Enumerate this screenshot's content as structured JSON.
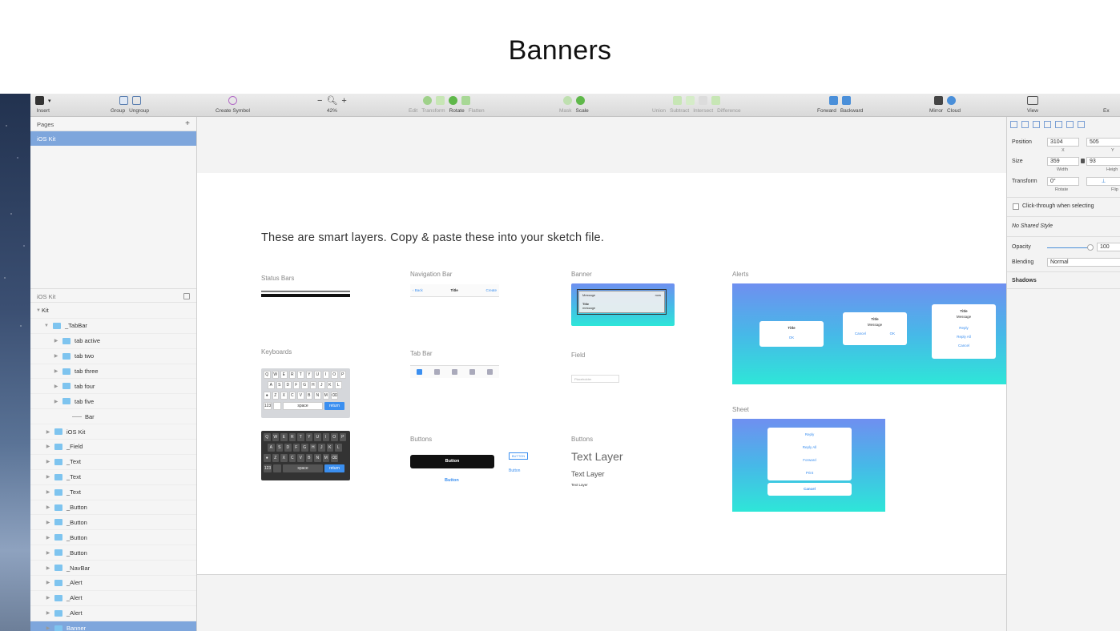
{
  "slide_title": "Banners",
  "toolbar": {
    "insert": "Insert",
    "group": "Group",
    "ungroup": "Ungroup",
    "create_symbol": "Create Symbol",
    "zoom_minus": "−",
    "zoom_plus": "+",
    "zoom": "42%",
    "edit": "Edit",
    "transform": "Transform",
    "rotate": "Rotate",
    "flatten": "Flatten",
    "mask": "Mask",
    "scale": "Scale",
    "union": "Union",
    "subtract": "Subtract",
    "intersect": "Intersect",
    "difference": "Difference",
    "forward": "Forward",
    "backward": "Backward",
    "mirror": "Mirror",
    "cloud": "Cloud",
    "view": "View",
    "export": "Ex"
  },
  "pages": {
    "header": "Pages",
    "add": "+",
    "items": [
      "iOS Kit"
    ]
  },
  "layers": {
    "header": "iOS Kit",
    "items": [
      {
        "label": "Kit",
        "type": "page"
      },
      {
        "label": "_TabBar",
        "type": "folder",
        "expanded": true
      },
      {
        "label": "tab active",
        "type": "folder"
      },
      {
        "label": "tab two",
        "type": "folder"
      },
      {
        "label": "tab three",
        "type": "folder"
      },
      {
        "label": "tab four",
        "type": "folder"
      },
      {
        "label": "tab five",
        "type": "folder"
      },
      {
        "label": "Bar",
        "type": "line"
      },
      {
        "label": "iOS Kit",
        "type": "folder"
      },
      {
        "label": "_Field",
        "type": "folder"
      },
      {
        "label": "_Text",
        "type": "folder"
      },
      {
        "label": "_Text",
        "type": "folder"
      },
      {
        "label": "_Text",
        "type": "folder"
      },
      {
        "label": "_Button",
        "type": "folder"
      },
      {
        "label": "_Button",
        "type": "folder"
      },
      {
        "label": "_Button",
        "type": "folder"
      },
      {
        "label": "_Button",
        "type": "folder"
      },
      {
        "label": "_NavBar",
        "type": "folder"
      },
      {
        "label": "_Alert",
        "type": "folder"
      },
      {
        "label": "_Alert",
        "type": "folder"
      },
      {
        "label": "_Alert",
        "type": "folder"
      },
      {
        "label": "Banner",
        "type": "folder",
        "selected": true
      }
    ]
  },
  "canvas": {
    "headline": "These are smart layers. Copy & paste these into your sketch file.",
    "sections": {
      "status_bars": "Status Bars",
      "navigation_bar": "Navigation Bar",
      "banner": "Banner",
      "alerts": "Alerts",
      "keyboards": "Keyboards",
      "tab_bar": "Tab Bar",
      "field": "Field",
      "sheet": "Sheet",
      "buttons_1": "Buttons",
      "buttons_2": "Buttons"
    },
    "nav_bar": {
      "back": "‹ Back",
      "title": "Title",
      "action": "Create"
    },
    "banner_preview": {
      "app": "Message",
      "time": "now",
      "title": "Title",
      "message": "message"
    },
    "field_placeholder": "Placeholder",
    "buttons": {
      "primary": "Button",
      "outline": "BUTTON",
      "link": "Button",
      "link2": "Button"
    },
    "text_layers": {
      "large": "Text Layer",
      "medium": "Text Layer",
      "small": "Text Layer"
    },
    "keyboard_rows": [
      [
        "Q",
        "W",
        "E",
        "R",
        "T",
        "Y",
        "U",
        "I",
        "O",
        "P"
      ],
      [
        "A",
        "S",
        "D",
        "F",
        "G",
        "H",
        "J",
        "K",
        "L"
      ],
      [
        "Z",
        "X",
        "C",
        "V",
        "B",
        "N",
        "M"
      ]
    ],
    "keyboard_light": {
      "num": "123",
      "space": "space",
      "return": "return"
    },
    "keyboard_dark": {
      "num": "123",
      "space": "space",
      "return": "return"
    },
    "alerts": {
      "a1": {
        "title": "Title",
        "ok": "OK"
      },
      "a2": {
        "title": "Title",
        "message": "Message",
        "cancel": "Cancel",
        "ok": "OK"
      },
      "a3": {
        "title": "Title",
        "message": "Message",
        "reply": "Reply",
        "reply_all": "Reply All",
        "cancel": "Cancel"
      }
    },
    "sheet": {
      "items": [
        "Reply",
        "Reply All",
        "Forward",
        "Print"
      ],
      "cancel": "Cancel"
    }
  },
  "inspector": {
    "position_label": "Position",
    "x_value": "3104",
    "y_value": "505",
    "x_sub": "X",
    "y_sub": "Y",
    "size_label": "Size",
    "width_value": "359",
    "height_value": "93",
    "width_sub": "Width",
    "height_sub": "Heigh",
    "transform_label": "Transform",
    "rotate_value": "0°",
    "rotate_sub": "Rotate",
    "flip_sub": "Flip",
    "click_through": "Click-through when selecting",
    "shared_style": "No Shared Style",
    "opacity_label": "Opacity",
    "opacity_value": "100",
    "blending_label": "Blending",
    "blending_value": "Normal",
    "shadows_label": "Shadows"
  }
}
